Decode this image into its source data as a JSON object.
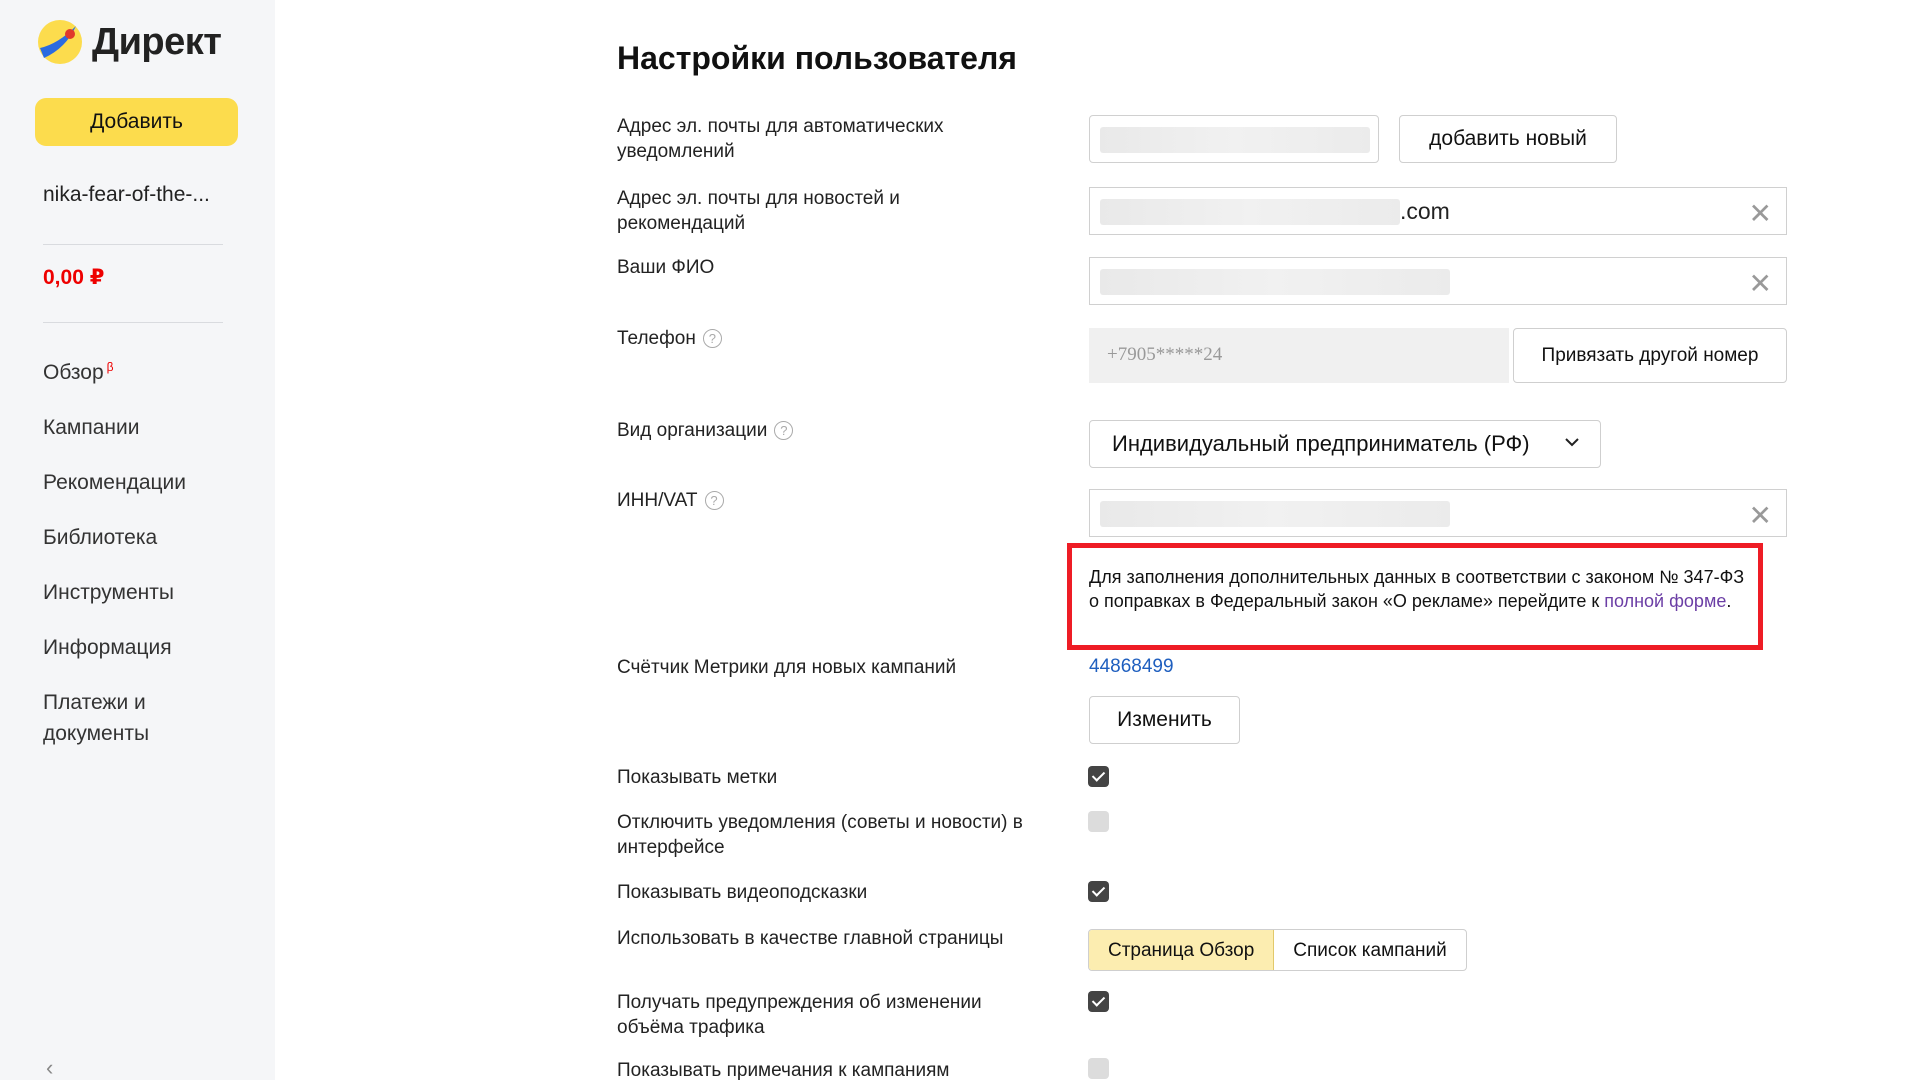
{
  "sidebar": {
    "logo_text": "Директ",
    "add_label": "Добавить",
    "account": "nika-fear-of-the-...",
    "balance": "0,00 ₽",
    "nav": [
      {
        "label": "Обзор",
        "badge": "β"
      },
      {
        "label": "Кампании"
      },
      {
        "label": "Рекомендации"
      },
      {
        "label": "Библиотека"
      },
      {
        "label": "Инструменты"
      },
      {
        "label": "Информация"
      },
      {
        "label": "Платежи и документы"
      }
    ],
    "collapse_icon": "‹"
  },
  "main": {
    "title": "Настройки пользователя",
    "email_auto": {
      "label": "Адрес эл. почты для автоматических уведомлений",
      "add_label": "добавить новый"
    },
    "email_news": {
      "label": "Адрес эл. почты для новостей и рекомендаций",
      "suffix": ".com"
    },
    "fio": {
      "label": "Ваши ФИО"
    },
    "phone": {
      "label": "Телефон",
      "value": "+7905*****24",
      "rebind_label": "Привязать другой номер"
    },
    "org": {
      "label": "Вид организации",
      "value": "Индивидуальный предприниматель (РФ)"
    },
    "inn": {
      "label": "ИНН/VAT"
    },
    "help_glyph": "?",
    "clear_glyph": "✕",
    "notice": {
      "text": "Для заполнения дополнительных данных в соответствии с законом № 347-ФЗ о поправках в Федеральный закон «О рекламе» перейдите к ",
      "link": "полной форме",
      "end": "."
    },
    "metrika": {
      "label": "Счётчик Метрики для новых кампаний",
      "value": "44868499",
      "change_label": "Изменить"
    },
    "show_tags": {
      "label": "Показывать метки",
      "checked": true
    },
    "disable_notif": {
      "label": "Отключить уведомления (советы и новости) в интерфейсе",
      "checked": false
    },
    "show_video": {
      "label": "Показывать видеоподсказки",
      "checked": true
    },
    "main_page": {
      "label": "Использовать в качестве главной страницы",
      "options": [
        "Страница Обзор",
        "Список кампаний"
      ],
      "selected": "Страница Обзор"
    },
    "traffic_warn": {
      "label": "Получать предупреждения об изменении объёма трафика",
      "checked": true
    },
    "show_notes": {
      "label": "Показывать примечания к кампаниям",
      "checked": false
    }
  },
  "colors": {
    "accent_yellow": "#fcdc4d",
    "balance_red": "#ee0000",
    "notice_border": "#ee1c25",
    "link_blue": "#1f5fbf"
  }
}
